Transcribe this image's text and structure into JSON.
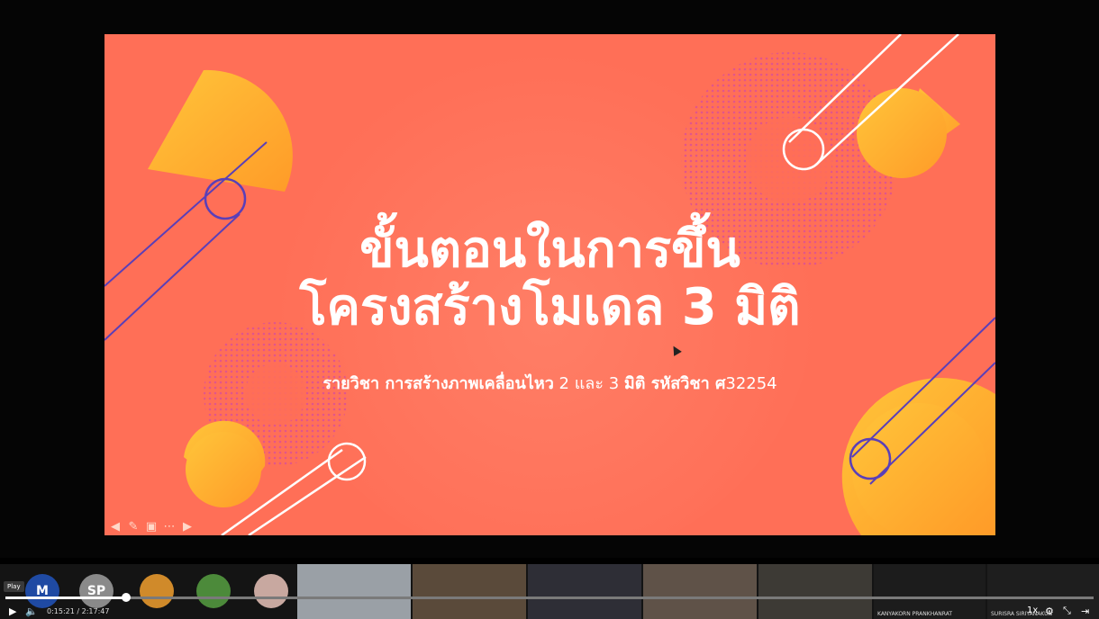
{
  "slide": {
    "title_line1": "ขั้นตอนในการขึ้น",
    "title_line2": "โครงสร้างโมเดล 3 มิติ",
    "subtitle_bold1": "รายวิชา การสร้างภาพเคลื่อนไหว",
    "subtitle_plain1": " 2 และ 3 ",
    "subtitle_bold2": "มิติ  รหัสวิชา ศ",
    "subtitle_code": "32254",
    "background_color": "#ff6f57",
    "accent_colors": [
      "#ffb52b",
      "#f07a9e",
      "#5a3fb8",
      "#ffffff"
    ]
  },
  "slide_tools": {
    "prev_icon": "arrow-left-icon",
    "pen_icon": "pencil-icon",
    "slides_icon": "slide-grid-icon",
    "more_icon": "ellipsis-icon",
    "next_icon": "arrow-right-icon"
  },
  "participants": {
    "avatars": [
      {
        "initials": "M",
        "color": "#1f4aa3"
      },
      {
        "initials": "SP",
        "color": "#8a8a8a"
      },
      {
        "initials": "",
        "color": "#d08a2a"
      },
      {
        "initials": "",
        "color": "#4c8a3a"
      },
      {
        "initials": "",
        "color": "#c8a8a0"
      }
    ],
    "videos": [
      {
        "color": "#9aa0a6",
        "name": ""
      },
      {
        "color": "#5a4a3a",
        "name": ""
      },
      {
        "color": "#2e2e36",
        "name": ""
      },
      {
        "color": "#5f5248",
        "name": ""
      },
      {
        "color": "#3d3a35",
        "name": ""
      },
      {
        "color": "#1c1c1c",
        "name": "KANYAKORN PRANKHANRAT"
      },
      {
        "color": "#1e1e1e",
        "name": "SURISRA SIRIYANAKUN"
      }
    ]
  },
  "player": {
    "tooltip": "Play",
    "time_current": "0:15:21",
    "time_total": "2:17:47",
    "time_display": "0:15:21 / 2:17:47",
    "progress_fraction": 0.111,
    "speed_label": "1x",
    "play_icon": "play-icon",
    "volume_icon": "volume-icon",
    "settings_icon": "gear-icon",
    "minimize_icon": "minimize-icon",
    "exit_icon": "exit-icon"
  }
}
